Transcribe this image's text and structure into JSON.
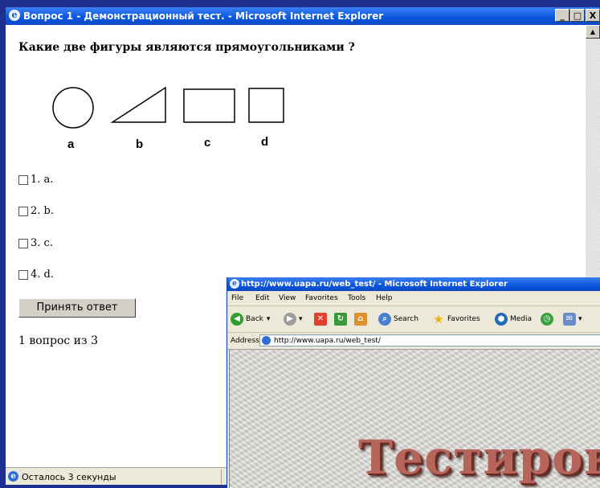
{
  "window1": {
    "title": "Вопрос 1 - Демонстрационный тест. - Microsoft Internet Explorer",
    "buttons": {
      "minimize": "_",
      "maximize": "□",
      "close": "X"
    }
  },
  "question": {
    "text": "Какие две фигуры являются прямоугольниками ?",
    "shape_labels": [
      "a",
      "b",
      "c",
      "d"
    ],
    "options": [
      "1. a.",
      "2. b.",
      "3. c.",
      "4. d."
    ],
    "submit_label": "Принять ответ",
    "counter": "1 вопрос из 3"
  },
  "status1": {
    "text": "Осталось 3 секунды"
  },
  "window2": {
    "title": "http://www.uapa.ru/web_test/ - Microsoft Internet Explorer",
    "menu": [
      "File",
      "Edit",
      "View",
      "Favorites",
      "Tools",
      "Help"
    ],
    "toolbar": {
      "back": "Back",
      "search": "Search",
      "favorites": "Favorites",
      "media": "Media"
    },
    "address_label": "Address",
    "url": "http://www.uapa.ru/web_test/",
    "page_text": "Тестирова"
  }
}
